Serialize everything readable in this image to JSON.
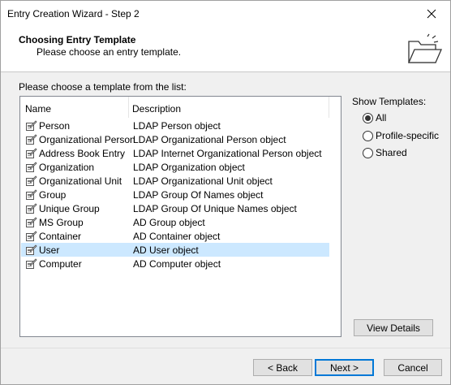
{
  "window": {
    "title": "Entry Creation Wizard - Step 2"
  },
  "header": {
    "title": "Choosing Entry Template",
    "subtitle": "Please choose an entry template."
  },
  "list": {
    "caption": "Please choose a template from the list:",
    "columns": {
      "name": "Name",
      "description": "Description"
    },
    "rows": [
      {
        "name": "Person",
        "description": "LDAP Person object"
      },
      {
        "name": "Organizational Person",
        "description": "LDAP Organizational Person object"
      },
      {
        "name": "Address Book Entry",
        "description": "LDAP Internet Organizational Person object"
      },
      {
        "name": "Organization",
        "description": "LDAP Organization object"
      },
      {
        "name": "Organizational Unit",
        "description": "LDAP Organizational Unit object"
      },
      {
        "name": "Group",
        "description": "LDAP Group Of Names object"
      },
      {
        "name": "Unique Group",
        "description": "LDAP Group Of Unique Names object"
      },
      {
        "name": "MS Group",
        "description": "AD Group object"
      },
      {
        "name": "Container",
        "description": "AD Container object"
      },
      {
        "name": "User",
        "description": "AD User object"
      },
      {
        "name": "Computer",
        "description": "AD Computer object"
      }
    ],
    "selected_index": 9
  },
  "show_templates": {
    "label": "Show Templates:",
    "options": [
      "All",
      "Profile-specific",
      "Shared"
    ],
    "selected": "All"
  },
  "buttons": {
    "view_details": "View Details",
    "back": "< Back",
    "next": "Next >",
    "cancel": "Cancel"
  },
  "icons": {
    "close": "close-icon",
    "header": "open-folder-icon",
    "row": "template-icon"
  },
  "colors": {
    "selection": "#cce8ff",
    "default_button_border": "#0078d7"
  }
}
